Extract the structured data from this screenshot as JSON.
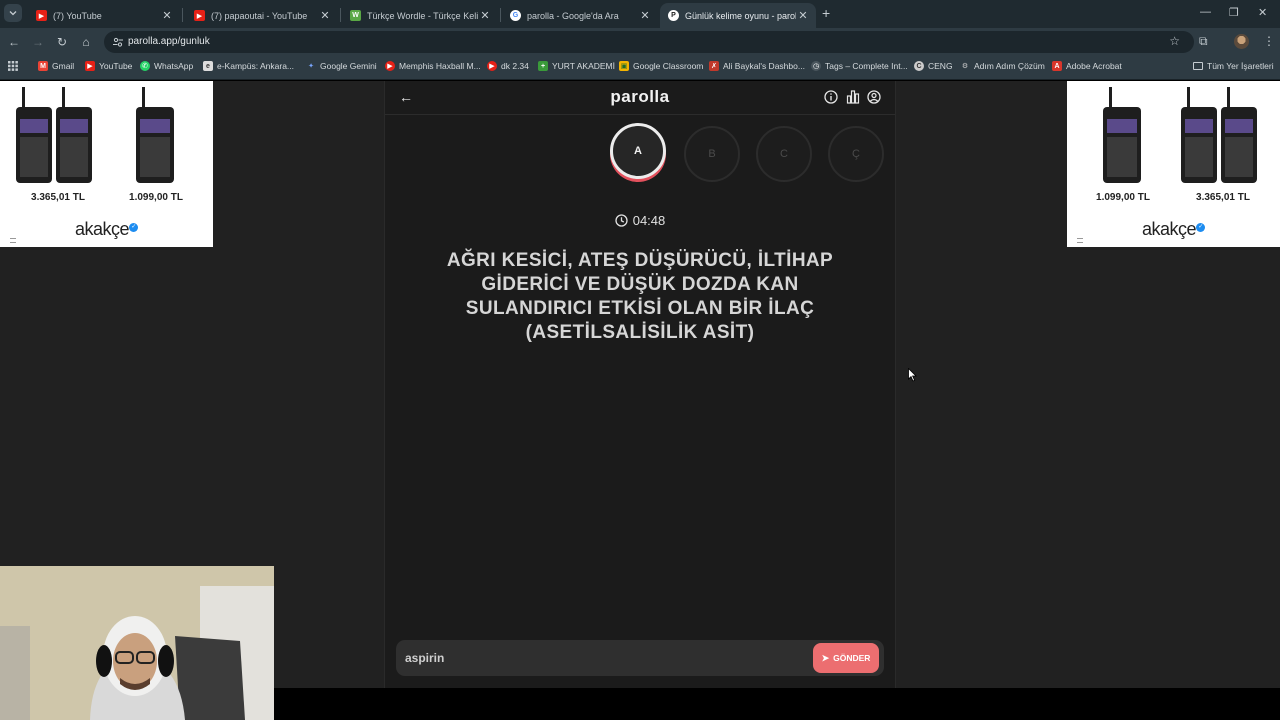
{
  "browser": {
    "tabs": [
      {
        "title": "(7) YouTube",
        "icon": "youtube-icon",
        "active": false
      },
      {
        "title": "(7) papaoutai - YouTube",
        "icon": "youtube-icon",
        "active": false
      },
      {
        "title": "Türkçe Wordle - Türkçe Kelime",
        "icon": "wordle-icon",
        "active": false
      },
      {
        "title": "parolla - Google'da Ara",
        "icon": "google-icon",
        "active": false
      },
      {
        "title": "Günlük kelime oyunu - parolla",
        "icon": "parolla-icon",
        "active": true
      }
    ],
    "url": "parolla.app/gunluk",
    "bookmarks": [
      "Gmail",
      "YouTube",
      "WhatsApp",
      "e-Kampüs: Ankara...",
      "Google Gemini",
      "Memphis Haxball M...",
      "dk 2.34",
      "YURT AKADEMİ",
      "Google Classroom",
      "Ali Baykal's Dashbo...",
      "Tags – Complete Int...",
      "CENG",
      "Adım Adım Çözüm",
      "Adobe Acrobat"
    ],
    "bookmarks_all": "Tüm Yer İşaretleri"
  },
  "ads": {
    "left": {
      "prices": [
        "3.365,01 TL",
        "1.099,00 TL"
      ],
      "brand": "akakçe"
    },
    "right": {
      "prices": [
        "1.099,00 TL",
        "3.365,01 TL"
      ],
      "brand": "akakçe"
    }
  },
  "game": {
    "logo": "parolla",
    "letters": [
      "A",
      "B",
      "C",
      "Ç"
    ],
    "current_letter_index": 0,
    "timer": "04:48",
    "clue": "AĞRI KESİCİ, ATEŞ DÜŞÜRÜCÜ, İLTİHAP GİDERİCİ VE DÜŞÜK DOZDA KAN SULANDIRICI ETKİSİ OLAN BİR İLAÇ (ASETİLSALİSİLİK ASİT)",
    "answer_value": "aspirin",
    "send_label": "GÖNDER"
  },
  "colors": {
    "accent": "#ec6e70",
    "page_bg": "#212121",
    "panel_bg": "#1b1b1b"
  }
}
